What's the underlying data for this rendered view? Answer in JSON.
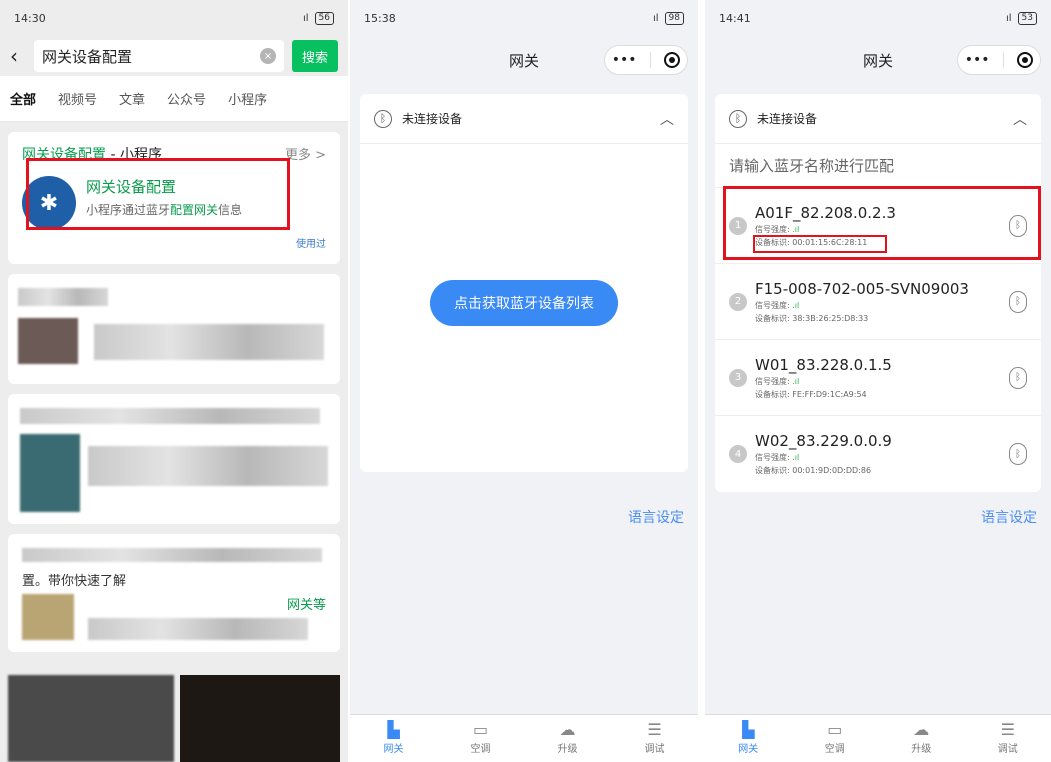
{
  "panel1": {
    "status": {
      "time": "14:30",
      "battery": "56"
    },
    "search": {
      "query": "网关设备配置",
      "button": "搜索"
    },
    "filters": [
      "全部",
      "视频号",
      "文章",
      "公众号",
      "小程序"
    ],
    "result": {
      "header_title": "网关设备配置",
      "header_suffix": "- 小程序",
      "more": "更多 >",
      "app_name": "网关设备配置",
      "desc_prefix": "小程序通过蓝牙",
      "desc_highlight": "配置网关",
      "desc_suffix": "信息",
      "used": "使用过"
    },
    "post_fragment": "置。带你快速了解",
    "post_keyword": "网关等"
  },
  "panel2": {
    "status": {
      "time": "15:38",
      "battery": "98"
    },
    "nav_title": "网关",
    "bt_status": "未连接设备",
    "fetch_button": "点击获取蓝牙设备列表",
    "lang": "语言设定",
    "tabs": [
      "网关",
      "空调",
      "升级",
      "调试"
    ]
  },
  "panel3": {
    "status": {
      "time": "14:41",
      "battery": "53"
    },
    "nav_title": "网关",
    "bt_status": "未连接设备",
    "match_placeholder": "请输入蓝牙名称进行匹配",
    "signal_label": "信号强度:",
    "mac_label": "设备标识:",
    "devices": [
      {
        "index": "1",
        "name": "A01F_82.208.0.2.3",
        "mac": "00:01:15:6C:28:11"
      },
      {
        "index": "2",
        "name": "F15-008-702-005-SVN09003",
        "mac": "38:3B:26:25:D8:33"
      },
      {
        "index": "3",
        "name": "W01_83.228.0.1.5",
        "mac": "FE:FF:D9:1C:A9:54"
      },
      {
        "index": "4",
        "name": "W02_83.229.0.0.9",
        "mac": "00:01:9D:0D:DD:86"
      }
    ],
    "lang": "语言设定",
    "tabs": [
      "网关",
      "空调",
      "升级",
      "调试"
    ]
  },
  "icons": {
    "bluetooth": "bluetooth-icon",
    "chevron_up": "chevron-up-icon",
    "more": "more-dots-icon",
    "target": "target-icon"
  }
}
